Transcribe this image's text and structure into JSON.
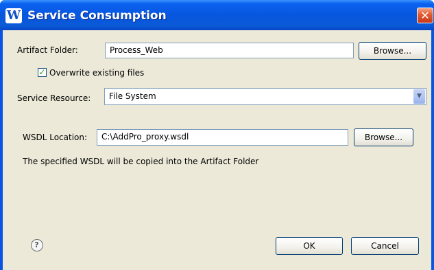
{
  "window": {
    "title": "Service Consumption",
    "app_icon_glyph": "W",
    "close_glyph": "✕"
  },
  "form": {
    "artifact_folder_label": "Artifact Folder:",
    "artifact_folder_value": "Process_Web",
    "browse_label_1": "Browse...",
    "overwrite_checked": true,
    "overwrite_label": "Overwrite existing files",
    "service_resource_label": "Service Resource:",
    "service_resource_value": "File System",
    "wsdl_location_label": "WSDL Location:",
    "wsdl_location_value": "C:\\AddPro_proxy.wsdl",
    "browse_label_2": "Browse...",
    "info_text": "The specified WSDL will be copied into the Artifact Folder"
  },
  "footer": {
    "ok_label": "OK",
    "cancel_label": "Cancel",
    "help_glyph": "?"
  },
  "icons": {
    "checkmark_glyph": "✓",
    "dropdown_glyph": "▼"
  }
}
